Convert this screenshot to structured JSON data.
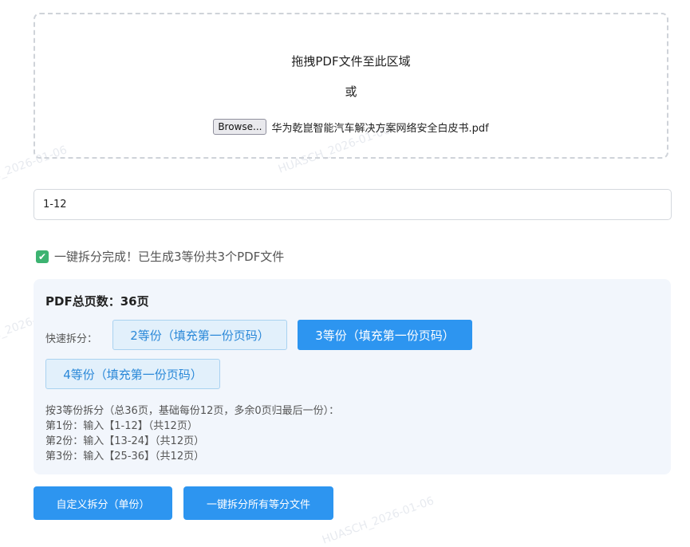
{
  "upload": {
    "drop_text": "拖拽PDF文件至此区域",
    "or_text": "或",
    "browse_label": "Browse...",
    "file_name": "华为乾崑智能汽车解决方案网络安全白皮书.pdf"
  },
  "range_input": {
    "value": "1-12"
  },
  "status": {
    "message": "一键拆分完成！已生成3等份共3个PDF文件"
  },
  "panel": {
    "total_pages": "PDF总页数：36页",
    "quick_label": "快速拆分：",
    "buttons": [
      {
        "label": "2等份（填充第一份页码）",
        "active": false
      },
      {
        "label": "3等份（填充第一份页码）",
        "active": true
      },
      {
        "label": "4等份（填充第一份页码）",
        "active": false
      }
    ],
    "info_lines": [
      "按3等份拆分（总36页，基础每份12页，多余0页归最后一份）：",
      "第1份：输入【1-12】（共12页）",
      "第2份：输入【13-24】（共12页）",
      "第3份：输入【25-36】（共12页）"
    ]
  },
  "actions": {
    "custom_split": "自定义拆分（单份）",
    "split_all": "一键拆分所有等分文件"
  },
  "watermark": {
    "text": "HUASCH_2026-01-06"
  },
  "colors": {
    "primary": "#2d95f0",
    "panel_bg": "#f2f6fc",
    "success": "#3cb371"
  }
}
